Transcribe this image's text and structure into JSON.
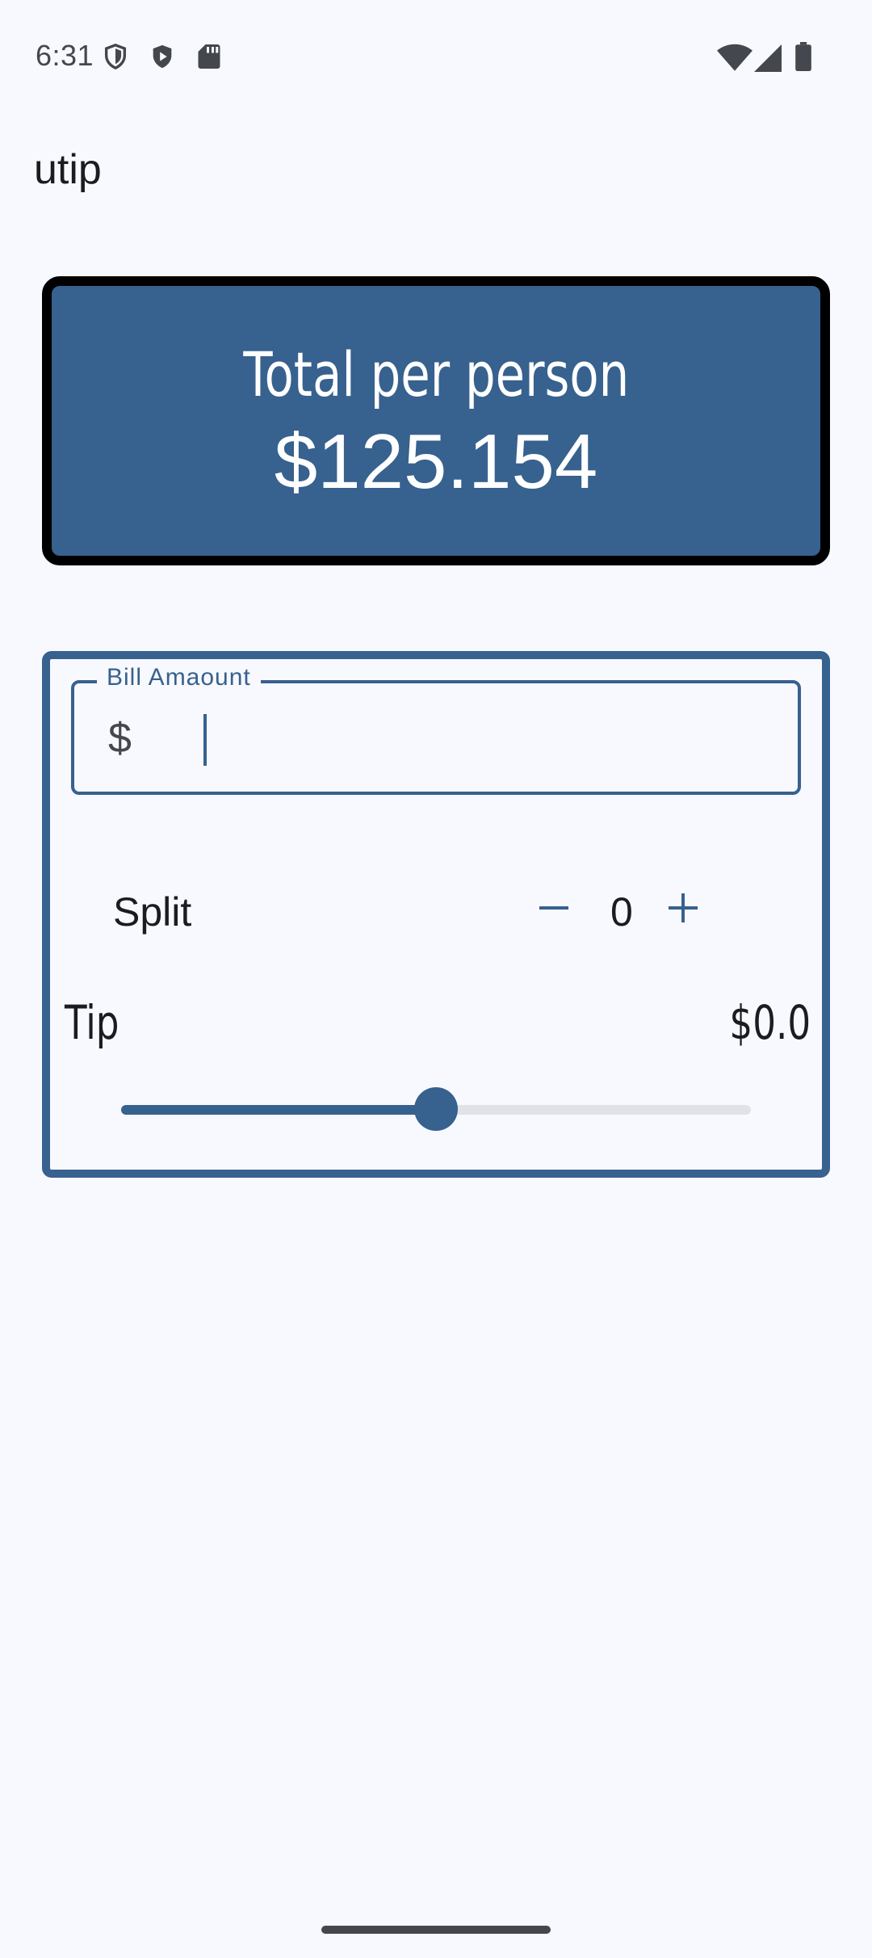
{
  "status_bar": {
    "time": "6:31",
    "left_icons": [
      "shield-icon",
      "play-protect-icon",
      "sd-card-icon"
    ],
    "right_icons": [
      "wifi-icon",
      "signal-icon",
      "battery-icon"
    ]
  },
  "app_bar": {
    "title": "utip"
  },
  "total_card": {
    "label": "Total per person",
    "value": "$125.154"
  },
  "bill_field": {
    "label": "Bill Amaount",
    "prefix": "$",
    "value": ""
  },
  "split": {
    "label": "Split",
    "decrement_symbol": "−",
    "count": "0",
    "increment_symbol": "+"
  },
  "tip": {
    "label": "Tip",
    "value": "$0.0",
    "slider_fraction": 0.5
  },
  "colors": {
    "primary": "#37618e",
    "background": "#f8f9ff",
    "card_border": "#000000",
    "track": "#e1e2e8"
  }
}
